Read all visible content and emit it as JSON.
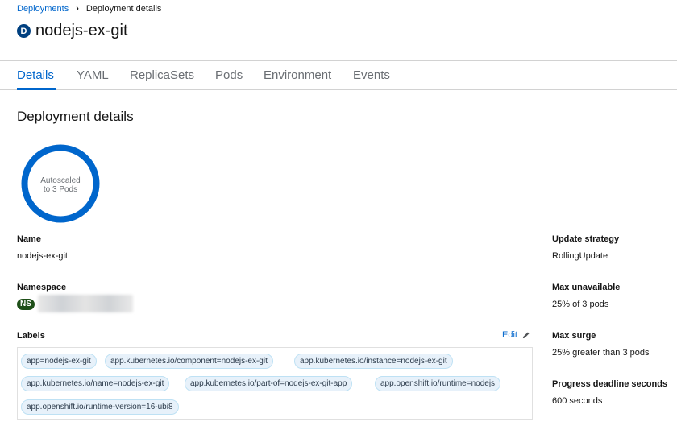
{
  "breadcrumb": {
    "parent": "Deployments",
    "current": "Deployment details"
  },
  "resource": {
    "badge": "D",
    "name": "nodejs-ex-git",
    "badge_color": "#004080"
  },
  "tabs": [
    {
      "label": "Details",
      "active": true
    },
    {
      "label": "YAML"
    },
    {
      "label": "ReplicaSets"
    },
    {
      "label": "Pods"
    },
    {
      "label": "Environment"
    },
    {
      "label": "Events"
    }
  ],
  "section_title": "Deployment details",
  "pod_ring": {
    "line1": "Autoscaled",
    "line2": "to 3 Pods",
    "ring_color": "#0066cc"
  },
  "left": {
    "name_label": "Name",
    "name_value": "nodejs-ex-git",
    "namespace_label": "Namespace",
    "namespace_badge": "NS",
    "labels_label": "Labels",
    "edit_label": "Edit",
    "labels": [
      "app=nodejs-ex-git",
      "app.kubernetes.io/component=nodejs-ex-git",
      "app.kubernetes.io/instance=nodejs-ex-git",
      "app.kubernetes.io/name=nodejs-ex-git",
      "app.kubernetes.io/part-of=nodejs-ex-git-app",
      "app.openshift.io/runtime=nodejs",
      "app.openshift.io/runtime-version=16-ubi8"
    ]
  },
  "right": {
    "strategy_label": "Update strategy",
    "strategy_value": "RollingUpdate",
    "max_unavailable_label": "Max unavailable",
    "max_unavailable_value": "25% of 3 pods",
    "max_surge_label": "Max surge",
    "max_surge_value": "25% greater than 3 pods",
    "deadline_label": "Progress deadline seconds",
    "deadline_value": "600 seconds"
  }
}
